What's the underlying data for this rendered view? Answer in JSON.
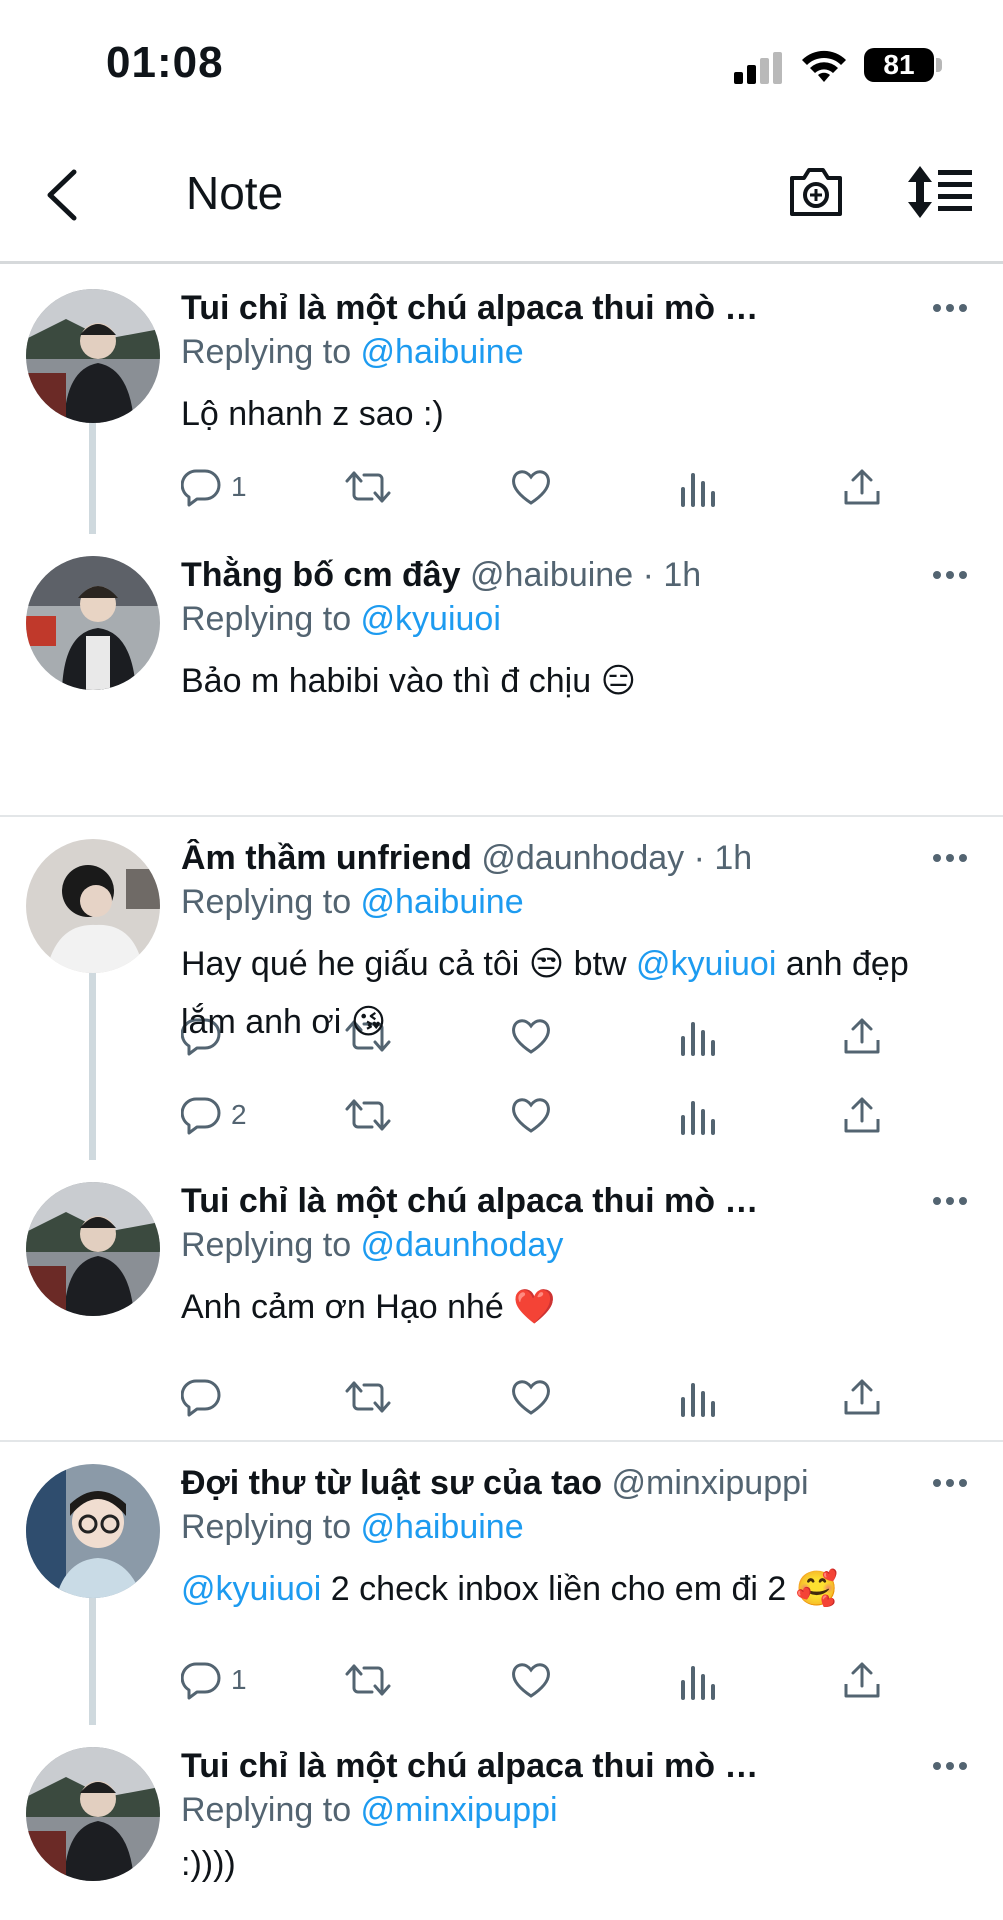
{
  "status_bar": {
    "time": "01:08",
    "battery": "81"
  },
  "header": {
    "title": "Note"
  },
  "tweets": [
    {
      "name": "Tui chỉ là một chú alpaca thui mò …",
      "handle": "",
      "replying_prefix": "Replying to ",
      "replying_to": "@haibuine",
      "text_before": "Lộ nhanh z sao :)",
      "mention": "",
      "text_after": "",
      "emoji": "",
      "reply_count": "1"
    },
    {
      "name": "Thằng bố cm đây",
      "handle": "@haibuine · 1h",
      "replying_prefix": "Replying to ",
      "replying_to": "@kyuiuoi",
      "text_before": "Bảo m habibi vào thì đ chịu",
      "mention": "",
      "text_after": "",
      "emoji": "😑",
      "reply_count": ""
    },
    {
      "name": "Âm thầm unfriend",
      "handle": "@daunhoday · 1h",
      "replying_prefix": "Replying to ",
      "replying_to": "@haibuine",
      "text_before": "Hay qué he giấu cả tôi 😒  btw ",
      "mention": "@kyuiuoi",
      "text_after": " anh đẹp lắm anh ơi",
      "emoji": "😘",
      "reply_count": "2"
    },
    {
      "name": "Tui chỉ là một chú alpaca thui mò …",
      "handle": "",
      "replying_prefix": "Replying to ",
      "replying_to": "@daunhoday",
      "text_before": "Anh cảm ơn Hạo nhé",
      "mention": "",
      "text_after": "",
      "emoji": "❤️",
      "reply_count": ""
    },
    {
      "name": "Đợi thư từ luật sư của tao",
      "handle": "@minxipuppi ·…",
      "replying_prefix": "Replying to ",
      "replying_to": "@haibuine",
      "text_before": "",
      "mention": "@kyuiuoi",
      "text_after": " 2 check inbox liền cho em đi 2",
      "emoji": "🥰",
      "reply_count": "1"
    },
    {
      "name": "Tui chỉ là một chú alpaca thui mò …",
      "handle": "",
      "replying_prefix": "Replying to ",
      "replying_to": "@minxipuppi",
      "text_before": ":))))",
      "mention": "",
      "text_after": "",
      "emoji": "",
      "reply_count": ""
    }
  ],
  "colors": {
    "link": "#1d9bf0",
    "secondary_text": "#536471",
    "primary_text": "#0f1419",
    "thread_line": "#cfd9de",
    "divider": "#e3e6e8"
  },
  "icons": [
    "back-chevron-icon",
    "camera-plus-icon",
    "sort-icon",
    "more-icon",
    "reply-icon",
    "retweet-icon",
    "like-icon",
    "views-icon",
    "share-icon"
  ]
}
